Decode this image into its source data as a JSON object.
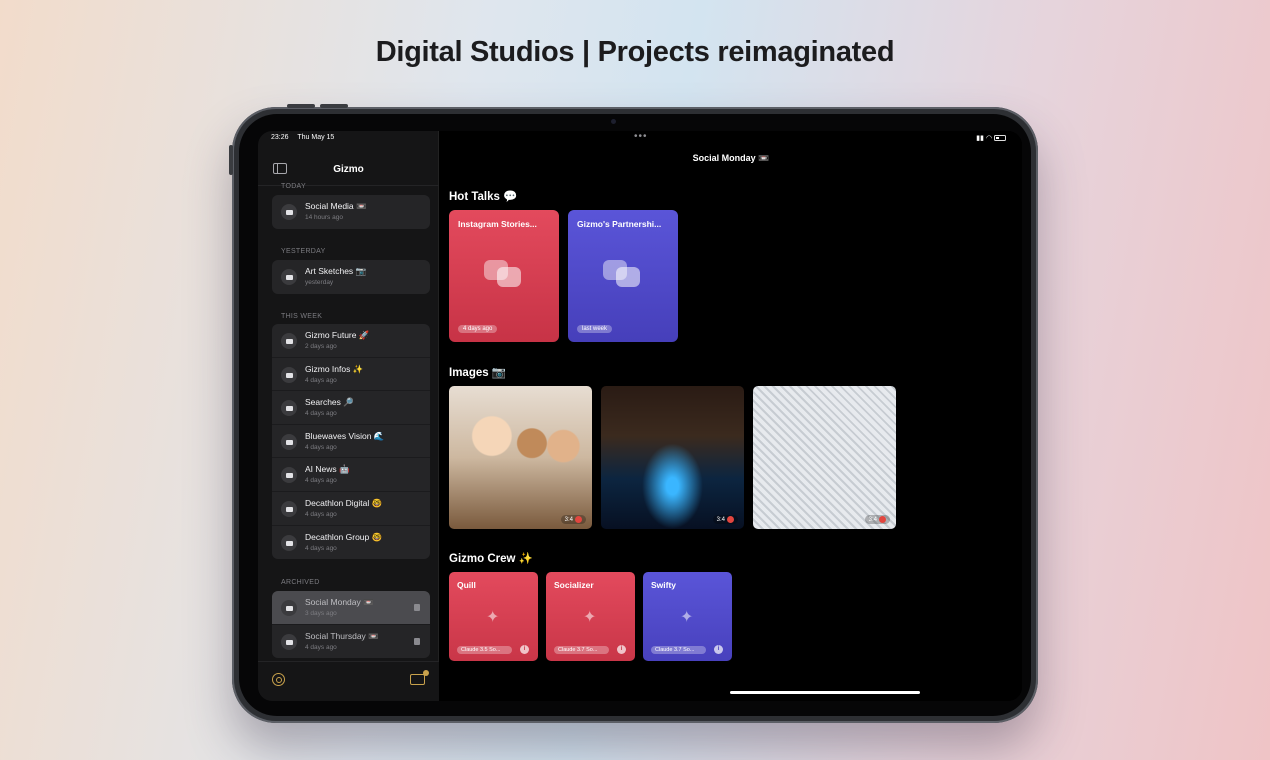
{
  "headline": "Digital Studios | Projects reimaginated",
  "status": {
    "time": "23:26",
    "date": "Thu May 15"
  },
  "sidebar": {
    "title": "Gizmo",
    "sections": [
      {
        "label": "TODAY",
        "items": [
          {
            "title": "Social Media 📼",
            "sub": "14 hours ago"
          }
        ]
      },
      {
        "label": "YESTERDAY",
        "items": [
          {
            "title": "Art Sketches 📷",
            "sub": "yesterday"
          }
        ]
      },
      {
        "label": "THIS WEEK",
        "items": [
          {
            "title": "Gizmo Future 🚀",
            "sub": "2 days ago"
          },
          {
            "title": "Gizmo Infos ✨",
            "sub": "4 days ago"
          },
          {
            "title": "Searches 🔎",
            "sub": "4 days ago"
          },
          {
            "title": "Bluewaves Vision 🌊",
            "sub": "4 days ago"
          },
          {
            "title": "AI News 🤖",
            "sub": "4 days ago"
          },
          {
            "title": "Decathlon Digital 🤓",
            "sub": "4 days ago"
          },
          {
            "title": "Decathlon Group 🤓",
            "sub": "4 days ago"
          }
        ]
      },
      {
        "label": "ARCHIVED",
        "items": [
          {
            "title": "Social Monday 📼",
            "sub": "3 days ago"
          },
          {
            "title": "Social Thursday 📼",
            "sub": "4 days ago"
          }
        ]
      }
    ]
  },
  "main": {
    "title": "Social Monday 📼",
    "hot_talks": {
      "heading": "Hot Talks 💬",
      "cards": [
        {
          "title": "Instagram Stories...",
          "tag": "4 days ago",
          "color": "#e34a5d"
        },
        {
          "title": "Gizmo's Partnershi...",
          "tag": "last week",
          "color": "#5a55d8"
        }
      ]
    },
    "images": {
      "heading": "Images 📷",
      "cards": [
        {
          "overlay": "3:4"
        },
        {
          "overlay": "3:4"
        },
        {
          "overlay": "3:4"
        }
      ]
    },
    "crew": {
      "heading": "Gizmo Crew ✨",
      "cards": [
        {
          "name": "Quill",
          "model": "Claude 3.5 So...",
          "color": "#e34a5d"
        },
        {
          "name": "Socializer",
          "model": "Claude 3.7 So...",
          "color": "#e34a5d"
        },
        {
          "name": "Swifty",
          "model": "Claude 3.7 So...",
          "color": "#5a55d8"
        }
      ]
    }
  },
  "icons": {
    "sidebar_toggle": "sidebar-toggle-icon",
    "folder": "folder-icon",
    "trash": "trash-icon",
    "settings": "gear-icon",
    "new_folder": "new-folder-icon",
    "chat": "chat-bubbles-icon",
    "sparkle": "sparkle-icon",
    "info": "info-icon"
  }
}
